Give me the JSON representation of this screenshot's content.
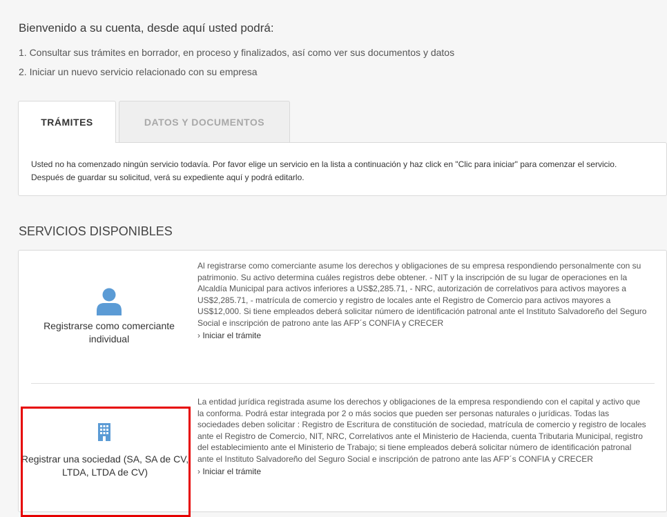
{
  "intro": {
    "title": "Bienvenido a su cuenta, desde aquí usted podrá:",
    "items": [
      "1. Consultar sus trámites en borrador, en proceso y finalizados, así como ver sus documentos y datos",
      "2. Iniciar un nuevo servicio relacionado con su empresa"
    ]
  },
  "tabs": [
    {
      "label": "TRÁMITES",
      "active": true
    },
    {
      "label": "DATOS Y DOCUMENTOS",
      "active": false
    }
  ],
  "tab_panel": {
    "message_line1": "Usted no ha comenzado ningún servicio todavía. Por favor elige un servicio en la lista a continuación y haz click en \"Clic para iniciar\" para comenzar el servicio.",
    "message_line2": "Después de guardar su solicitud, verá su expediente aquí y podrá editarlo."
  },
  "services": {
    "title": "SERVICIOS DISPONIBLES",
    "items": [
      {
        "icon": "user-icon",
        "title": "Registrarse como comerciante individual",
        "description": "Al registrarse como comerciante asume los derechos y obligaciones de su empresa respondiendo personalmente con su patrimonio. Su activo determina cuáles registros debe obtener. - NIT y la inscripción de su lugar de operaciones en la Alcaldía Municipal para activos inferiores a US$2,285.71, - NRC, autorización de correlativos para activos mayores a US$2,285.71, - matrícula de comercio y registro de locales ante el Registro de Comercio para activos mayores a US$12,000. Si tiene empleados deberá solicitar número de identificación patronal ante el Instituto Salvadoreño del Seguro Social e inscripción de patrono ante las AFP´s CONFIA y CRECER",
        "link": "Iniciar el trámite"
      },
      {
        "icon": "building-icon",
        "title": "Registrar una sociedad (SA, SA de CV, LTDA, LTDA de CV)",
        "description": "La entidad jurídica registrada asume los derechos y obligaciones de la empresa respondiendo con el capital y activo que la conforma. Podrá estar integrada por 2 o más socios que pueden ser personas naturales o jurídicas. Todas las sociedades deben solicitar : Registro de Escritura de constitución de sociedad, matrícula de comercio y registro de locales ante el Registro de Comercio, NIT, NRC, Correlativos ante el Ministerio de Hacienda, cuenta Tributaria Municipal, registro del establecimiento ante el Ministerio de Trabajo; si tiene empleados deberá solicitar número de identificación patronal ante el Instituto Salvadoreño del Seguro Social e inscripción de patrono ante las AFP´s CONFIA y CRECER",
        "link": "Iniciar el trámite"
      }
    ]
  },
  "colors": {
    "icon_blue": "#5b9bd5",
    "highlight_red": "#e60000"
  },
  "link_chevron": "›"
}
